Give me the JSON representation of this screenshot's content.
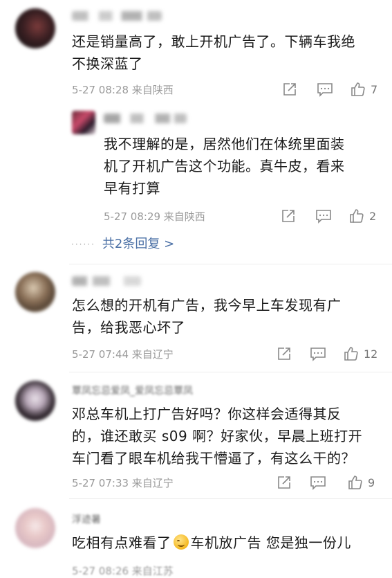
{
  "comments": [
    {
      "text_lines": [
        "还是销量高了，敢上开机广告了。下辆车我绝",
        "不换深蓝了"
      ],
      "meta": "5-27 08:28  来自陕西",
      "likes": "7",
      "reply": {
        "text_lines": [
          "我不理解的是，居然他们在体统里面装",
          "机了开机广告这个功能。真牛皮，看来",
          "早有打算"
        ],
        "meta": "5-27 08:29  来自陕西",
        "likes": "2"
      },
      "more_replies": "共2条回复 >"
    },
    {
      "text_lines": [
        "怎么想的开机有广告，我今早上车发现有广",
        "告，给我恶心坏了"
      ],
      "meta": "5-27 07:44  来自辽宁",
      "likes": "12"
    },
    {
      "name_text": "覃凤忘忌爱凤_爱凤忘忌覃凤",
      "text_lines": [
        "邓总车机上打广告好吗？你这样会适得其反",
        "的，谁还敢买 s09 啊？好家伙，早晨上班打开",
        "车门看了眼车机给我干懵逼了，有这么干的？"
      ],
      "meta": "5-27 07:33  来自辽宁",
      "likes": "9"
    },
    {
      "name_text": "浮迹暑",
      "text_before_emoji": "吃相有点难看了",
      "text_after_emoji": "车机放广告 您是独一份儿",
      "meta": "5-27 08:26  来自江苏"
    }
  ],
  "icons": {
    "share": "share-icon",
    "comment": "comment-icon",
    "like": "thumbs-up-icon",
    "emoji": "smile-emoji-icon"
  }
}
